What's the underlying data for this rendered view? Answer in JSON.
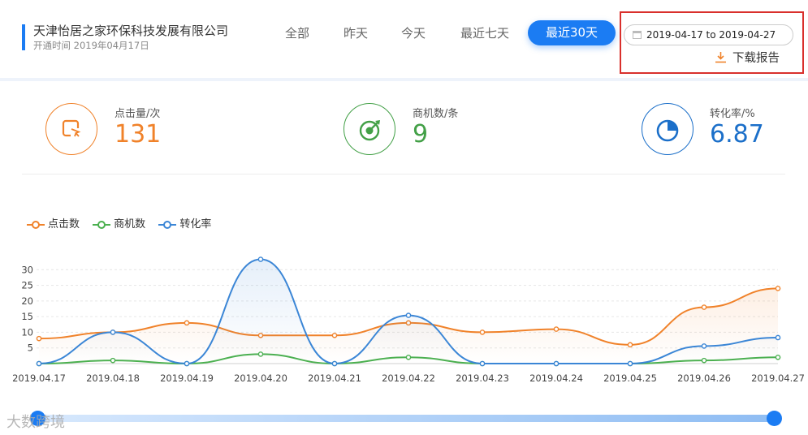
{
  "header": {
    "company": "天津怡居之家环保科技发展有限公司",
    "opened": "开通时间 2019年04月17日",
    "tabs": [
      "全部",
      "昨天",
      "今天",
      "最近七天"
    ],
    "active_tab": "最近30天",
    "date_range": "2019-04-17 to 2019-04-27",
    "download_label": "下载报告"
  },
  "stats": [
    {
      "label": "点击量/次",
      "value": "131",
      "color": "#f0822a",
      "icon": "click-icon"
    },
    {
      "label": "商机数/条",
      "value": "9",
      "color": "#43a047",
      "icon": "target-icon"
    },
    {
      "label": "转化率/%",
      "value": "6.87",
      "color": "#1b6fc9",
      "icon": "pie-icon"
    }
  ],
  "legend": [
    "点击数",
    "商机数",
    "转化率"
  ],
  "watermark": "大数跨境",
  "chart_data": {
    "type": "line",
    "categories": [
      "2019.04.17",
      "2019.04.18",
      "2019.04.19",
      "2019.04.20",
      "2019.04.21",
      "2019.04.22",
      "2019.04.23",
      "2019.04.24",
      "2019.04.25",
      "2019.04.26",
      "2019.04.27"
    ],
    "series": [
      {
        "name": "点击数",
        "color": "#f0822a",
        "values": [
          8,
          10,
          13,
          9,
          9,
          13,
          10,
          11,
          6,
          18,
          24
        ]
      },
      {
        "name": "商机数",
        "color": "#4cb050",
        "values": [
          0,
          1,
          0,
          3,
          0,
          2,
          0,
          0,
          0,
          1,
          2
        ]
      },
      {
        "name": "转化率",
        "color": "#3b86d6",
        "values": [
          0,
          10,
          0,
          33.3,
          0,
          15.4,
          0,
          0,
          0,
          5.6,
          8.3
        ]
      }
    ],
    "yticks": [
      5,
      10,
      15,
      20,
      25,
      30
    ],
    "ylim": [
      0,
      35
    ],
    "grid": true,
    "legend_position": "top-left"
  }
}
